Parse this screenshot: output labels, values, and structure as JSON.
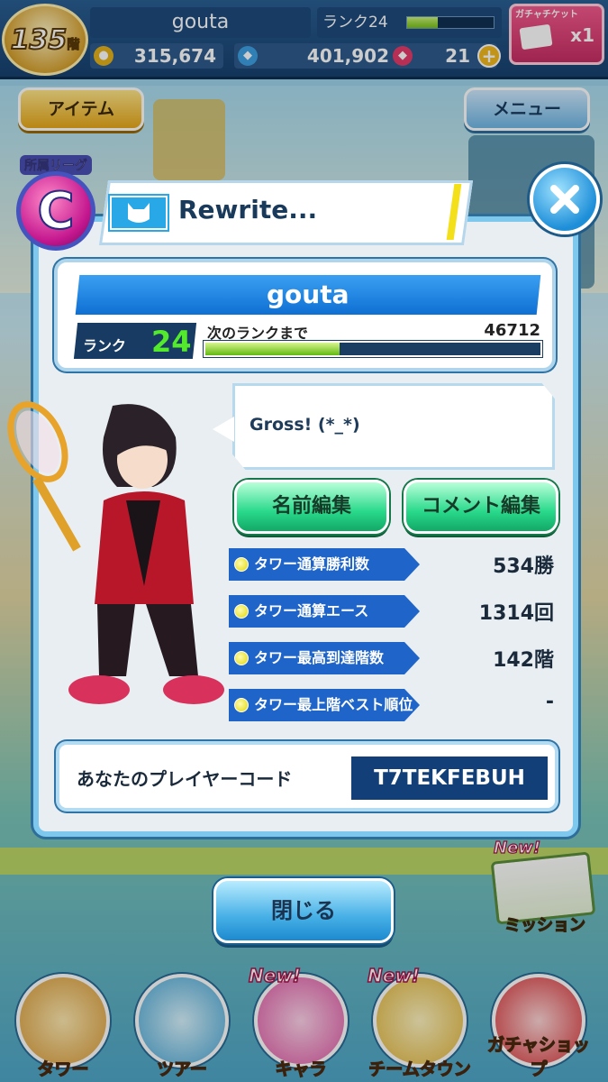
{
  "topbar": {
    "floor": "135",
    "floor_suffix": "階",
    "player_name": "gouta",
    "rank_label": "ランク24",
    "rank_progress": 0.35,
    "gacha_ticket_label": "ガチャチケット",
    "gacha_ticket_count": "x1",
    "coins": "315,674",
    "points": "401,902",
    "gems": "21"
  },
  "top_buttons": {
    "item_label": "アイテム",
    "menu_label": "メニュー"
  },
  "modal": {
    "league_label": "所属リーグ",
    "league_letter": "C",
    "team_name": "Rewrite...",
    "player_name": "gouta",
    "rank_label": "ランク",
    "rank_value": "24",
    "next_rank_label": "次のランクまで",
    "next_rank_value": "46712",
    "exp_progress": 0.4,
    "comment": "Gross!  (*_*)",
    "edit_name_label": "名前編集",
    "edit_comment_label": "コメント編集",
    "stats": [
      {
        "label": "タワー通算勝利数",
        "value": "534勝"
      },
      {
        "label": "タワー通算エース",
        "value": "1314回"
      },
      {
        "label": "タワー最高到達階数",
        "value": "142階"
      },
      {
        "label": "タワー最上階ベスト順位",
        "value": "-"
      }
    ],
    "player_code_label": "あなたのプレイヤーコード",
    "player_code": "T7TEKFEBUH",
    "close_label": "閉じる"
  },
  "mission": {
    "new": "New!",
    "label": "ミッション"
  },
  "bottom_nav": [
    {
      "label": "タワー",
      "new": ""
    },
    {
      "label": "ツアー",
      "new": ""
    },
    {
      "label": "キャラ",
      "new": "New!"
    },
    {
      "label": "チームタウン",
      "new": "New!"
    },
    {
      "label": "ガチャショップ",
      "new": ""
    }
  ],
  "colors": {
    "accent_blue": "#0f6fd3",
    "rank_green": "#54ea2c",
    "edit_button_green": "#29d98b",
    "code_navy": "#123f78"
  }
}
